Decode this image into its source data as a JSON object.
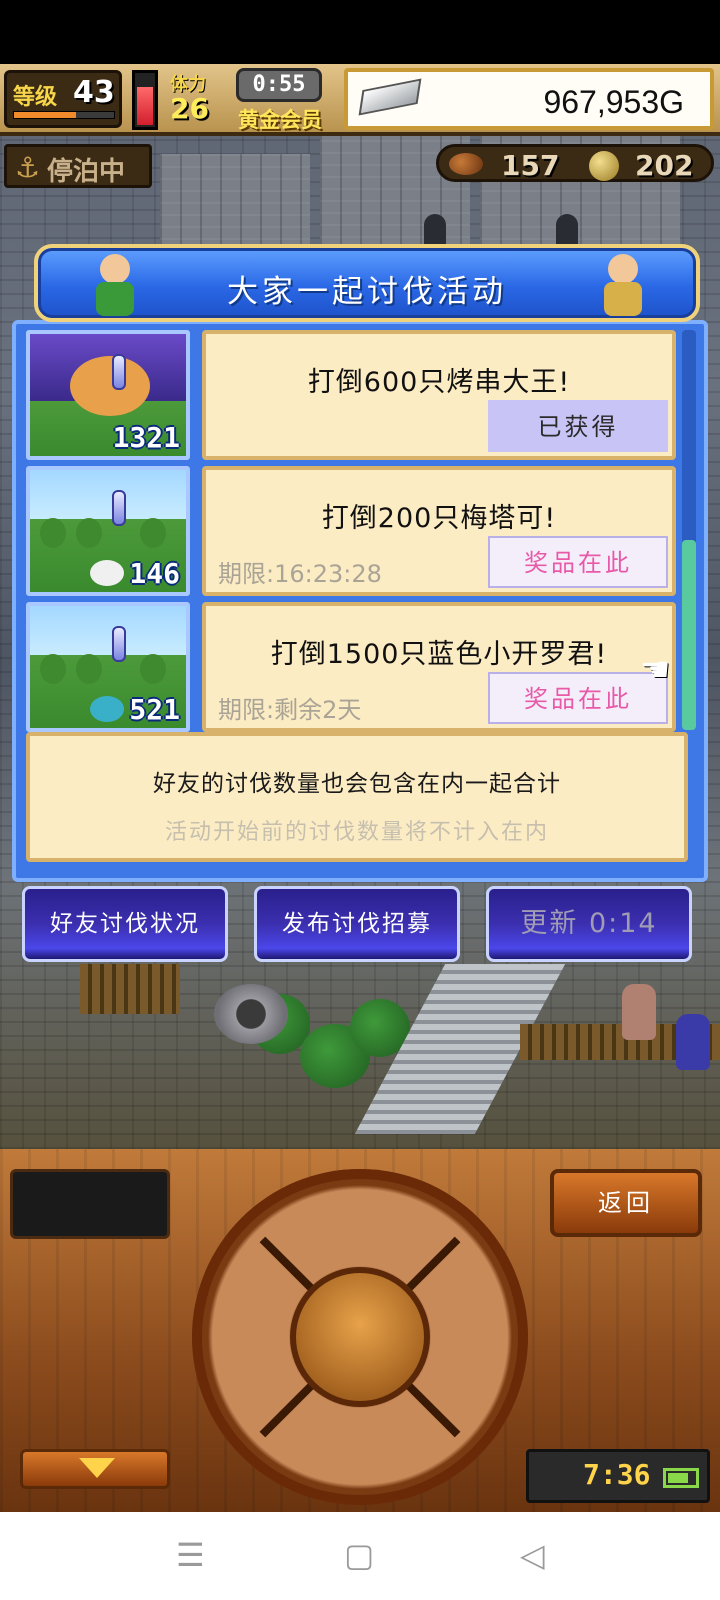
{
  "hud": {
    "level_label": "等级",
    "level": "43",
    "stamina_label": "体力",
    "stamina": "26",
    "timer": "0:55",
    "membership": "黄金会员",
    "gold": "967,953G",
    "status": "停泊中",
    "resource_meat": "157",
    "resource_coin": "202"
  },
  "event": {
    "title": "大家一起讨伐活动",
    "quests": [
      {
        "title": "打倒600只烤串大王!",
        "count": "1321",
        "limit": "",
        "button": "已获得"
      },
      {
        "title": "打倒200只梅塔可!",
        "count": "146",
        "limit": "期限:16:23:28",
        "button": "奖品在此"
      },
      {
        "title": "打倒1500只蓝色小开罗君!",
        "count": "521",
        "limit": "期限:剩余2天",
        "button": "奖品在此"
      }
    ],
    "note_main": "好友的讨伐数量也会包含在内一起合计",
    "note_sub": "活动开始前的讨伐数量将不计入在内"
  },
  "actions": {
    "friends": "好友讨伐状况",
    "recruit": "发布讨伐招募",
    "refresh": "更新 0:14"
  },
  "controller": {
    "back": "返回",
    "clock": "7:36"
  },
  "system_nav": {
    "menu": "☰",
    "home": "▢",
    "back": "◁"
  }
}
